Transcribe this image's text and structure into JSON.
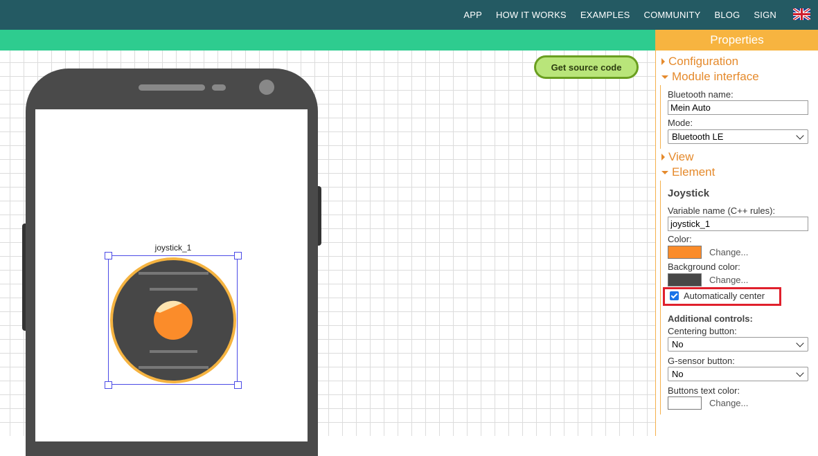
{
  "nav": {
    "items": [
      "APP",
      "HOW IT WORKS",
      "EXAMPLES",
      "COMMUNITY",
      "BLOG",
      "SIGN"
    ],
    "flag_icon": "uk-flag-icon"
  },
  "canvas": {
    "source_button": "Get source code",
    "element_label": "joystick_1"
  },
  "colors": {
    "topbar": "#245a63",
    "accent_green": "#2ecc8f",
    "panel_orange": "#f7b440",
    "section_orange": "#e58a2c",
    "joystick_color": "#fb8c2a",
    "joystick_background": "#474747",
    "buttons_text_color": "#ffffff"
  },
  "properties": {
    "title": "Properties",
    "sections": {
      "configuration": "Configuration",
      "module_interface": "Module interface",
      "view": "View",
      "element": "Element"
    },
    "module_interface": {
      "bluetooth_name_label": "Bluetooth name:",
      "bluetooth_name_value": "Mein Auto",
      "mode_label": "Mode:",
      "mode_value": "Bluetooth LE"
    },
    "element": {
      "type": "Joystick",
      "variable_label": "Variable name (C++ rules):",
      "variable_value": "joystick_1",
      "color_label": "Color:",
      "bg_color_label": "Background color:",
      "change_label": "Change...",
      "auto_center_label": "Automatically center",
      "auto_center_checked": true,
      "additional_label": "Additional controls:",
      "centering_label": "Centering button:",
      "centering_value": "No",
      "gsensor_label": "G-sensor button:",
      "gsensor_value": "No",
      "btn_text_color_label": "Buttons text color:"
    }
  }
}
